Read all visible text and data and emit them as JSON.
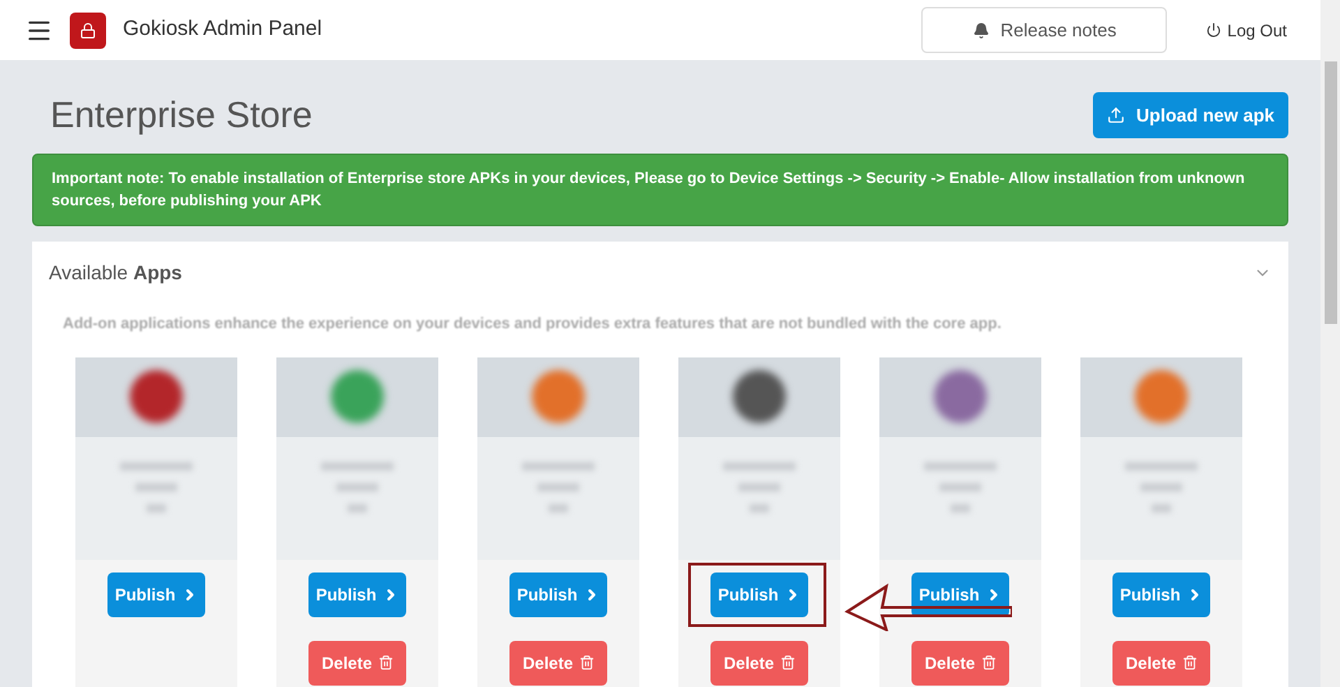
{
  "header": {
    "title": "Gokiosk Admin Panel",
    "release_notes": "Release notes",
    "logout": "Log Out"
  },
  "page": {
    "title": "Enterprise Store",
    "upload_button": "Upload new apk"
  },
  "notice": "Important note: To enable installation of Enterprise store APKs in your devices, Please go to Device Settings -> Security -> Enable- Allow installation from unknown sources, before publishing your APK",
  "panel": {
    "title_prefix": "Available ",
    "title_bold": "Apps",
    "description": "Add-on applications enhance the experience on your devices and provides extra features that are not bundled with the core app."
  },
  "apps": [
    {
      "color": "#b3262a",
      "publish": "Publish",
      "highlighted": false
    },
    {
      "color": "#3aa35a",
      "publish": "Publish",
      "delete": "Delete",
      "highlighted": false
    },
    {
      "color": "#e2702a",
      "publish": "Publish",
      "delete": "Delete",
      "highlighted": false
    },
    {
      "color": "#555555",
      "publish": "Publish",
      "delete": "Delete",
      "highlighted": true
    },
    {
      "color": "#8a6aa0",
      "publish": "Publish",
      "delete": "Delete",
      "highlighted": false
    },
    {
      "color": "#e2702a",
      "publish": "Publish",
      "delete": "Delete",
      "highlighted": false
    }
  ]
}
